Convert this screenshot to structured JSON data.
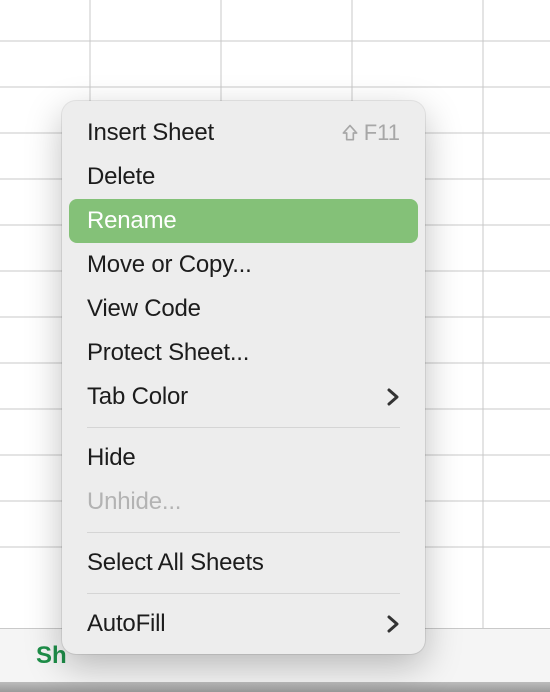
{
  "sheet_tab_partial": "Sh",
  "menu": {
    "items": [
      {
        "label": "Insert Sheet",
        "shortcut_key": "F11"
      },
      {
        "label": "Delete"
      },
      {
        "label": "Rename"
      },
      {
        "label": "Move or Copy..."
      },
      {
        "label": "View Code"
      },
      {
        "label": "Protect Sheet..."
      },
      {
        "label": "Tab Color"
      },
      {
        "label": "Hide"
      },
      {
        "label": "Unhide..."
      },
      {
        "label": "Select All Sheets"
      },
      {
        "label": "AutoFill"
      }
    ]
  }
}
